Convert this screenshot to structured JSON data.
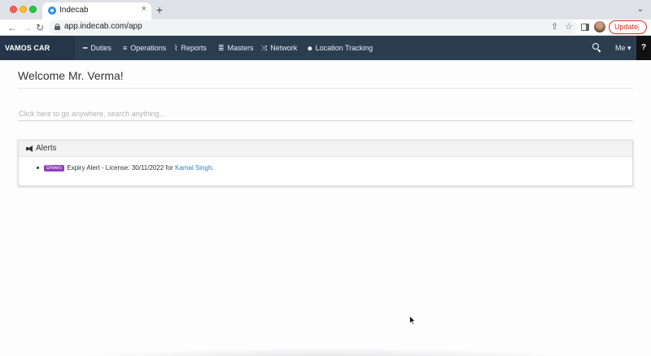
{
  "browser": {
    "tab_title": "Indecab",
    "tab_close": "×",
    "new_tab": "+",
    "url": "app.indecab.com/app",
    "update_label": "Update",
    "update_menu": "⋮",
    "chevron": "⌄",
    "back": "←",
    "forward": "→",
    "reload": "↻",
    "share": "⇪",
    "star": "☆"
  },
  "navbar": {
    "brand": "VAMOS CAR RENTAL",
    "items": [
      {
        "label": "Duties",
        "icon": "minus-icon",
        "glyph": "━"
      },
      {
        "label": "Operations",
        "icon": "list-icon",
        "glyph": "≡"
      },
      {
        "label": "Reports",
        "icon": "line-chart-icon",
        "glyph": "⌇"
      },
      {
        "label": "Masters",
        "icon": "database-icon",
        "glyph": "≣"
      },
      {
        "label": "Network",
        "icon": "random-icon",
        "glyph": "⤨"
      },
      {
        "label": "Location Tracking",
        "icon": "map-marker-icon",
        "glyph": "⬤"
      }
    ],
    "me_label": "Me ▾",
    "help_label": "?"
  },
  "page": {
    "welcome": "Welcome Mr. Verma!",
    "search_placeholder": "Click here to go anywhere, search anything..."
  },
  "alerts": {
    "title": "Alerts",
    "items": [
      {
        "badge": "Drivers",
        "text": "Expiry Alert - License: 30/11/2022 for ",
        "link": "Kamal Singh",
        "suffix": "."
      }
    ]
  },
  "colors": {
    "navbar": "#2b3e50",
    "brand_bg": "#25364a",
    "badge": "#8e3fb8",
    "link": "#2a7fc5",
    "update": "#d93025"
  }
}
